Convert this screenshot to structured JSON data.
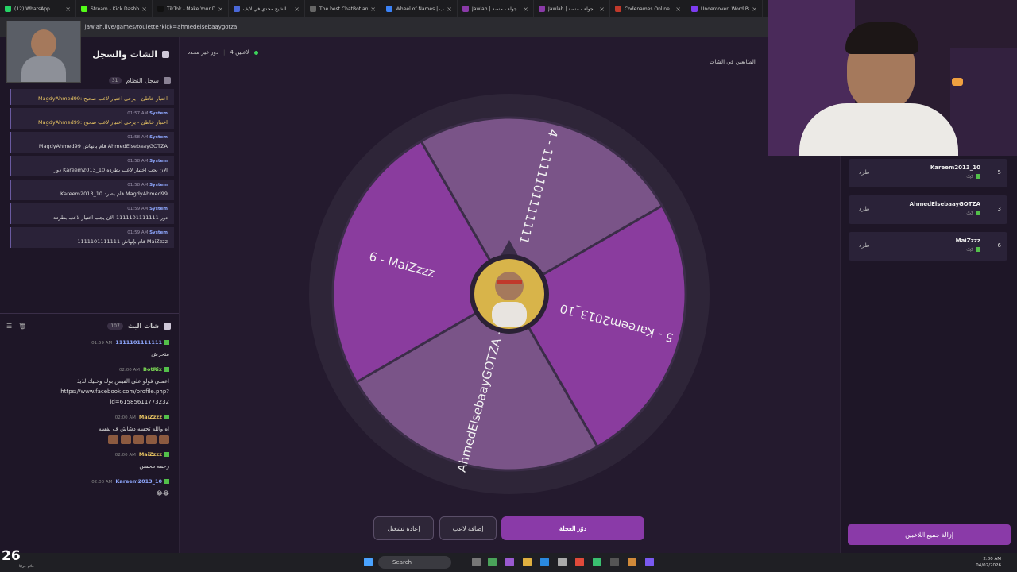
{
  "browser": {
    "tabs": [
      {
        "title": "(12) WhatsApp",
        "color": "#25d366"
      },
      {
        "title": "Stream - Kick Dashbo",
        "color": "#53fc18"
      },
      {
        "title": "TikTok - Make Your D",
        "color": "#111111"
      },
      {
        "title": "الشيخ مجدي في لايف",
        "color": "#4a68d8"
      },
      {
        "title": "The best ChatBot an",
        "color": "#666666"
      },
      {
        "title": "Wheel of Names | تب",
        "color": "#3b82f6"
      },
      {
        "title": "Jawlah | جولة - منصة",
        "color": "#8a3aa8"
      },
      {
        "title": "Jawlah | جولة - منصة",
        "color": "#8a3aa8"
      },
      {
        "title": "Codenames Online",
        "color": "#c0392b"
      },
      {
        "title": "Undercover: Word Pa",
        "color": "#7d3cf0"
      }
    ],
    "url": "jawlah.live/games/roulette?kick=ahmedelsebaaygotza"
  },
  "chat_panel": {
    "title": "الشات والسجل",
    "system_log": {
      "title": "سجل النظام",
      "count": "31",
      "entries": [
        {
          "name": "",
          "time": "",
          "msg": "MagdyAhmed99: اختيار خاطئ - يرجى اختيار لاعب صحيح",
          "warn": true
        },
        {
          "name": "System",
          "time": "01:57 AM",
          "msg": "MagdyAhmed99: اختيار خاطئ - يرجى اختيار لاعب صحيح",
          "warn": true
        },
        {
          "name": "System",
          "time": "01:58 AM",
          "msg": "MagdyAhmed99 قام بإنهاش AhmedElsebaayGOTZA",
          "warn": false
        },
        {
          "name": "System",
          "time": "01:58 AM",
          "msg": "دور Kareem2013_10 الان يجب اختيار لاعب بطرده",
          "warn": false
        },
        {
          "name": "System",
          "time": "01:58 AM",
          "msg": "Kareem2013_10 قام بطرد MagdyAhmed99",
          "warn": false
        },
        {
          "name": "System",
          "time": "01:59 AM",
          "msg": "دور 1111101111111 الان يجب اختيار لاعب بطرده",
          "warn": false
        },
        {
          "name": "System",
          "time": "01:59 AM",
          "msg": "1111101111111 قام بإنهاش MaiZzzz",
          "warn": false
        }
      ]
    },
    "stream_chat": {
      "title": "شات البث",
      "count": "107",
      "messages": [
        {
          "name": "1111101111111",
          "color": "#8fa8ff",
          "time": "01:59 AM",
          "text": "متحرش",
          "emotes": 0
        },
        {
          "name": "BotRix",
          "color": "#7ddc55",
          "time": "02:00 AM",
          "text": "اعملي فولو على الفيس بوك وخليك لذيذ https://www.facebook.com/profile.php?id=61585611773232",
          "emotes": 0
        },
        {
          "name": "MaiZzzz",
          "color": "#e8c462",
          "time": "02:00 AM",
          "text": "اه والله تحسه دشاش ف نفسه",
          "emotes": 5
        },
        {
          "name": "MaiZzzz",
          "color": "#e8c462",
          "time": "02:00 AM",
          "text": "رحمه محسن",
          "emotes": 0
        },
        {
          "name": "Kareem2013_10",
          "color": "#8fa8ff",
          "time": "02:00 AM",
          "text": "😂😂",
          "emotes": 0
        }
      ]
    }
  },
  "game": {
    "players_count_label": "4 لاعبين",
    "turn_label": "دور غير محدد",
    "followers_label": "المتابعين في الشات",
    "wheel_segments": [
      {
        "label": "4 - 1111101111111",
        "color": "#7a5488"
      },
      {
        "label": "5 - Kareem2013_10",
        "color": "#8a3c9e"
      },
      {
        "label": "AhmedElsebaayGOTZA -",
        "color": "#7a5488"
      },
      {
        "label": "6 - MaiZzzz",
        "color": "#8a3c9e"
      }
    ],
    "buttons": {
      "spin": "دوّر العجلة",
      "add_player": "إضافة لاعب",
      "restart": "إعادة تشغيل"
    }
  },
  "players": [
    {
      "num": "5",
      "name": "Kareem2013_10",
      "platform": "كيك",
      "kick_label": "طرد"
    },
    {
      "num": "3",
      "name": "AhmedElsebaayGOTZA",
      "platform": "كيك",
      "kick_label": "طرد"
    },
    {
      "num": "6",
      "name": "MaiZzzz",
      "platform": "كيك",
      "kick_label": "طرد"
    }
  ],
  "remove_all_label": "إزالة جميع اللاعبين",
  "taskbar": {
    "search_placeholder": "Search",
    "time": "2:00 AM",
    "date": "04/02/2026",
    "weather_temp": "26",
    "weather_label": "غائم جزئيًا"
  }
}
